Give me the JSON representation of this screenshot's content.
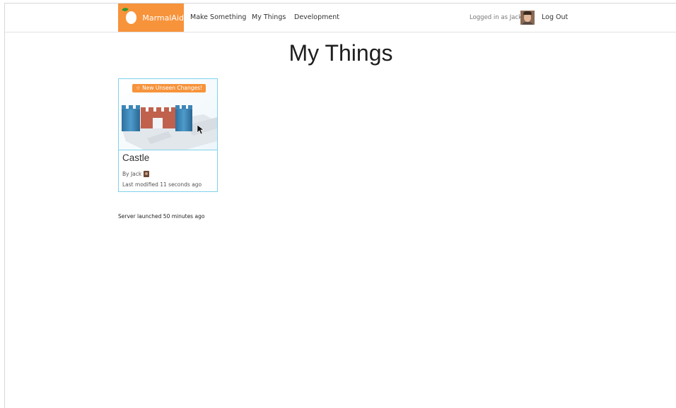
{
  "navbar": {
    "brand": "MarmalAid",
    "links": [
      "Make Something",
      "My Things",
      "Development"
    ],
    "logged_in_text": "Logged in as Jack",
    "logout_label": "Log Out"
  },
  "page": {
    "title": "My Things"
  },
  "things": [
    {
      "badge": "☆ New Unseen Changes!",
      "name": "Castle",
      "author": "By Jack",
      "modified": "Last modified 11 seconds ago"
    }
  ],
  "footer": {
    "server_status": "Server launched 50 minutes ago"
  },
  "colors": {
    "brand_orange": "#f7933b",
    "card_border": "#7fd2ea",
    "tower_blue": "#3b86b8",
    "wall_red": "#c0614d"
  },
  "icons": [
    "orange-logo-icon",
    "user-avatar",
    "cursor-icon"
  ]
}
